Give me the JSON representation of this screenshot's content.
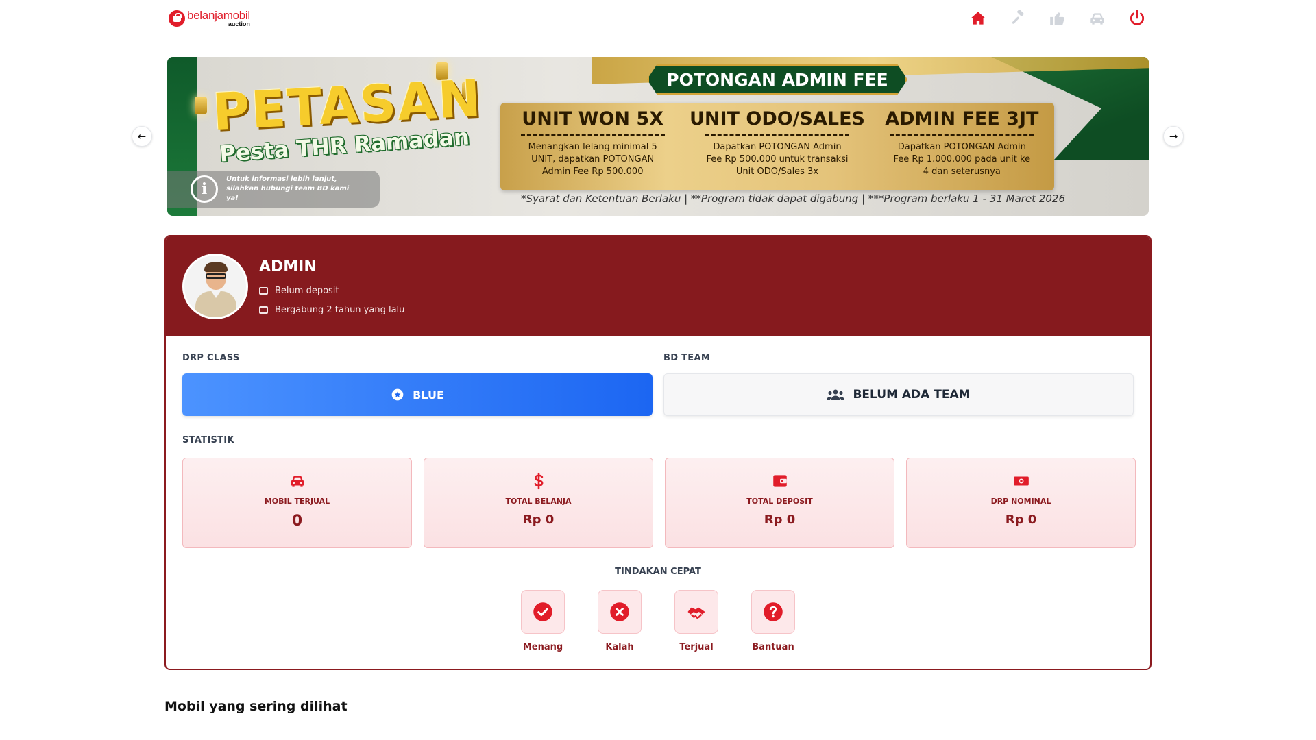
{
  "header": {
    "logo_name": "belanjamobil",
    "logo_sub": "auction",
    "nav": [
      {
        "icon": "home-icon",
        "color": "#e11d2a"
      },
      {
        "icon": "gavel-icon",
        "color": "#d1d5db"
      },
      {
        "icon": "thumbs-up-icon",
        "color": "#d1d5db"
      },
      {
        "icon": "car-icon",
        "color": "#d1d5db"
      },
      {
        "icon": "power-icon",
        "color": "#e11d2a"
      }
    ]
  },
  "banner": {
    "headline": "PETASAN",
    "subheadline": "Pesta THR Ramadan",
    "info_text": "Untuk informasi lebih lanjut, silahkan hubungi team BD kami ya!",
    "ribbon": "POTONGAN ADMIN FEE",
    "promos": [
      {
        "title": "UNIT WON 5X",
        "text": "Menangkan lelang minimal 5 UNIT, dapatkan POTONGAN Admin Fee Rp 500.000"
      },
      {
        "title": "UNIT ODO/SALES",
        "text": "Dapatkan POTONGAN Admin Fee Rp 500.000 untuk transaksi Unit ODO/Sales 3x"
      },
      {
        "title": "ADMIN FEE 3JT",
        "text": "Dapatkan POTONGAN Admin Fee Rp 1.000.000 pada unit ke 4 dan seterusnya"
      }
    ],
    "disclaimer": "*Syarat dan Ketentuan Berlaku | **Program tidak dapat digabung | ***Program berlaku  1 - 31 Maret 2026",
    "prev_label": "←",
    "next_label": "→"
  },
  "profile": {
    "name": "ADMIN",
    "deposit_status": "Belum deposit",
    "joined": "Bergabung 2 tahun yang lalu"
  },
  "drp_class": {
    "label": "DRP CLASS",
    "value": "BLUE",
    "color": "#1c66f2"
  },
  "bd_team": {
    "label": "BD TEAM",
    "value": "BELUM ADA TEAM"
  },
  "statistik": {
    "label": "STATISTIK",
    "items": [
      {
        "icon": "car-icon",
        "label": "MOBIL TERJUAL",
        "value": "0"
      },
      {
        "icon": "dollar-icon",
        "label": "TOTAL BELANJA",
        "value": "Rp 0"
      },
      {
        "icon": "wallet-icon",
        "label": "TOTAL DEPOSIT",
        "value": "Rp 0"
      },
      {
        "icon": "cash-icon",
        "label": "DRP NOMINAL",
        "value": "Rp 0"
      }
    ]
  },
  "quick_actions": {
    "label": "TINDAKAN CEPAT",
    "items": [
      {
        "icon": "check-circle-icon",
        "label": "Menang"
      },
      {
        "icon": "x-circle-icon",
        "label": "Kalah"
      },
      {
        "icon": "handshake-icon",
        "label": "Terjual"
      },
      {
        "icon": "question-circle-icon",
        "label": "Bantuan"
      }
    ]
  },
  "recent": {
    "title": "Mobil yang sering dilihat"
  },
  "colors": {
    "brand_red": "#e11d2a",
    "maroon": "#861a1e",
    "blue": "#1c66f2"
  }
}
